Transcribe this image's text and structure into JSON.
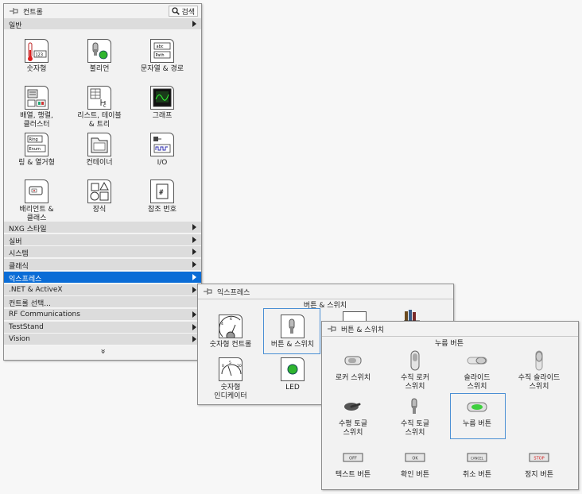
{
  "main": {
    "title": "컨트롤",
    "search_label": "검색",
    "general": "일반",
    "items": [
      {
        "label": "숫자형",
        "icon": "numeric-icon"
      },
      {
        "label": "불리언",
        "icon": "boolean-icon"
      },
      {
        "label": "문자열 & 경로",
        "icon": "string-path-icon"
      },
      {
        "label": "배열, 행렬,\n클러스터",
        "icon": "array-matrix-cluster-icon"
      },
      {
        "label": "리스트, 테이블\n& 트리",
        "icon": "list-table-tree-icon"
      },
      {
        "label": "그래프",
        "icon": "graph-icon"
      },
      {
        "label": "링 & 열거형",
        "icon": "ring-enum-icon"
      },
      {
        "label": "컨테이너",
        "icon": "container-icon"
      },
      {
        "label": "I/O",
        "icon": "io-icon"
      },
      {
        "label": "배리언트 &\n클래스",
        "icon": "variant-class-icon"
      },
      {
        "label": "장식",
        "icon": "decorations-icon"
      },
      {
        "label": "참조 번호",
        "icon": "refnum-icon"
      }
    ],
    "categories": [
      {
        "label": "NXG 스타일",
        "arrow": true
      },
      {
        "label": "실버",
        "arrow": true
      },
      {
        "label": "시스템",
        "arrow": true
      },
      {
        "label": "클래식",
        "arrow": true
      },
      {
        "label": "익스프레스",
        "arrow": true,
        "selected": true
      },
      {
        "label": ".NET & ActiveX",
        "arrow": true
      },
      {
        "label": "컨트롤 선택...",
        "arrow": false
      },
      {
        "label": "RF Communications",
        "arrow": true
      },
      {
        "label": "TestStand",
        "arrow": true
      },
      {
        "label": "Vision",
        "arrow": true
      }
    ],
    "more": "»"
  },
  "express": {
    "title": "익스프레스",
    "hover_caption": "버튼 & 스위치",
    "items": [
      {
        "label": "숫자형 컨트롤",
        "icon": "numeric-control-icon"
      },
      {
        "label": "버튼 & 스위치",
        "icon": "buttons-switches-icon"
      },
      {
        "label": "숫자형\n인디케이터",
        "icon": "numeric-indicator-icon"
      },
      {
        "label": "LED",
        "icon": "led-icon"
      }
    ]
  },
  "buttons": {
    "title": "버튼 & 스위치",
    "hover_caption": "누름 버튼",
    "items": [
      {
        "label": "로커 스위치",
        "icon": "rocker-switch-icon"
      },
      {
        "label": "수직 로커\n스위치",
        "icon": "vertical-rocker-switch-icon"
      },
      {
        "label": "슬라이드\n스위치",
        "icon": "slide-switch-icon"
      },
      {
        "label": "수직 슬라이드\n스위치",
        "icon": "vertical-slide-switch-icon"
      },
      {
        "label": "수평 토글\n스위치",
        "icon": "horizontal-toggle-switch-icon"
      },
      {
        "label": "수직 토글\n스위치",
        "icon": "vertical-toggle-switch-icon"
      },
      {
        "label": "누름 버튼",
        "icon": "push-button-icon"
      },
      {
        "label": "텍스트 버튼",
        "icon": "text-button-icon",
        "face": "OFF"
      },
      {
        "label": "확인 버튼",
        "icon": "ok-button-icon",
        "face": "OK"
      },
      {
        "label": "취소 버튼",
        "icon": "cancel-button-icon",
        "face": "CANCEL"
      },
      {
        "label": "정지 버튼",
        "icon": "stop-button-icon",
        "face": "STOP"
      }
    ]
  },
  "colors": {
    "selected": "#0a6cd6",
    "category_bg": "#dcdcdc",
    "led_green": "#2fb52f",
    "stop_red": "#d42020"
  }
}
